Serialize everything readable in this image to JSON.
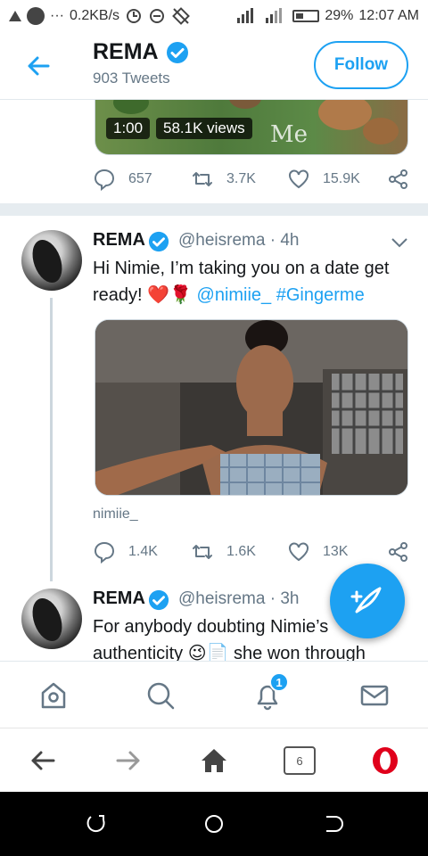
{
  "status_bar": {
    "net_speed": "0.2KB/s",
    "battery": "29%",
    "time": "12:07 AM"
  },
  "header": {
    "back_icon": "arrow-left-icon",
    "profile_name": "REMA",
    "tweet_count": "903 Tweets",
    "follow_label": "Follow"
  },
  "video_tweet": {
    "duration": "1:00",
    "views": "58.1K views",
    "overlay_text": "Me",
    "replies": "657",
    "retweets": "3.7K",
    "likes": "15.9K"
  },
  "tweets": [
    {
      "name": "REMA",
      "handle": "@heisrema · 4h",
      "text_plain": "Hi Nimie, I’m taking you on a date get ready! ❤️🌹 ",
      "mention": "@nimiie_",
      "hashtag": "#Gingerme",
      "photo_caption": "nimiie_",
      "replies": "1.4K",
      "retweets": "1.6K",
      "likes": "13K"
    },
    {
      "name": "REMA",
      "handle": "@heisrema · 3h",
      "text": "For anybody doubting Nimie’s authenticity 😉📄 she won through"
    }
  ],
  "tab_bar": {
    "notifications_badge": "1",
    "icons": [
      "home-icon",
      "search-icon",
      "notifications-icon",
      "messages-icon"
    ]
  },
  "browser_bar": {
    "tabs_count": "6",
    "icons": [
      "back-arrow-icon",
      "forward-arrow-icon",
      "home-icon",
      "tabs-icon",
      "opera-icon"
    ]
  },
  "colors": {
    "accent": "#1da1f2",
    "opera_red": "#e0001b",
    "heart_red": "#e0245e"
  }
}
